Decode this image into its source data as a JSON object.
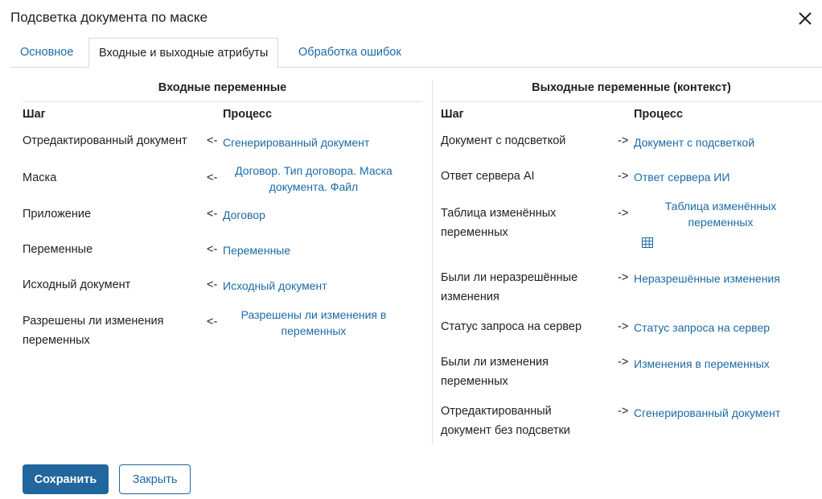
{
  "dialog": {
    "title": "Подсветка документа по маске"
  },
  "tabs": [
    {
      "label": "Основное"
    },
    {
      "label": "Входные и выходные атрибуты"
    },
    {
      "label": "Обработка ошибок"
    }
  ],
  "active_tab": "Входные и выходные атрибуты",
  "input": {
    "title": "Входные переменные",
    "col_step": "Шаг",
    "col_process": "Процесс",
    "arrow": "<-",
    "rows": [
      {
        "step": "Отредактированный документ",
        "process": "Сгенерированный документ"
      },
      {
        "step": "Маска",
        "process": "Договор. Тип договора. Маска документа. Файл"
      },
      {
        "step": "Приложение",
        "process": "Договор"
      },
      {
        "step": "Переменные",
        "process": "Переменные"
      },
      {
        "step": "Исходный документ",
        "process": "Исходный документ"
      },
      {
        "step": "Разрешены ли изменения переменных",
        "process": "Разрешены ли изменения в переменных"
      }
    ]
  },
  "output": {
    "title": "Выходные переменные (контекст)",
    "col_step": "Шаг",
    "col_process": "Процесс",
    "arrow": "->",
    "rows": [
      {
        "step": "Документ с подсветкой",
        "process": "Документ с подсветкой"
      },
      {
        "step": "Ответ сервера AI",
        "process": "Ответ сервера ИИ"
      },
      {
        "step": "Таблица изменённых переменных",
        "process": "Таблица изменённых переменных",
        "icon": "table-icon"
      },
      {
        "step": "Были ли неразрешённые изменения",
        "process": "Неразрешённые изменения"
      },
      {
        "step": "Статус запроса на сервер",
        "process": "Статус запроса на сервер"
      },
      {
        "step": "Были ли изменения переменных",
        "process": "Изменения в переменных"
      },
      {
        "step": "Отредактированный документ без подсветки",
        "process": "Сгенерированный документ"
      }
    ]
  },
  "buttons": {
    "save": "Сохранить",
    "close": "Закрыть"
  },
  "colors": {
    "link": "#1b6aa5",
    "primary": "#21669c",
    "divider": "#e2e2e2"
  },
  "icons": {
    "close": "close-icon",
    "table": "table-icon"
  }
}
